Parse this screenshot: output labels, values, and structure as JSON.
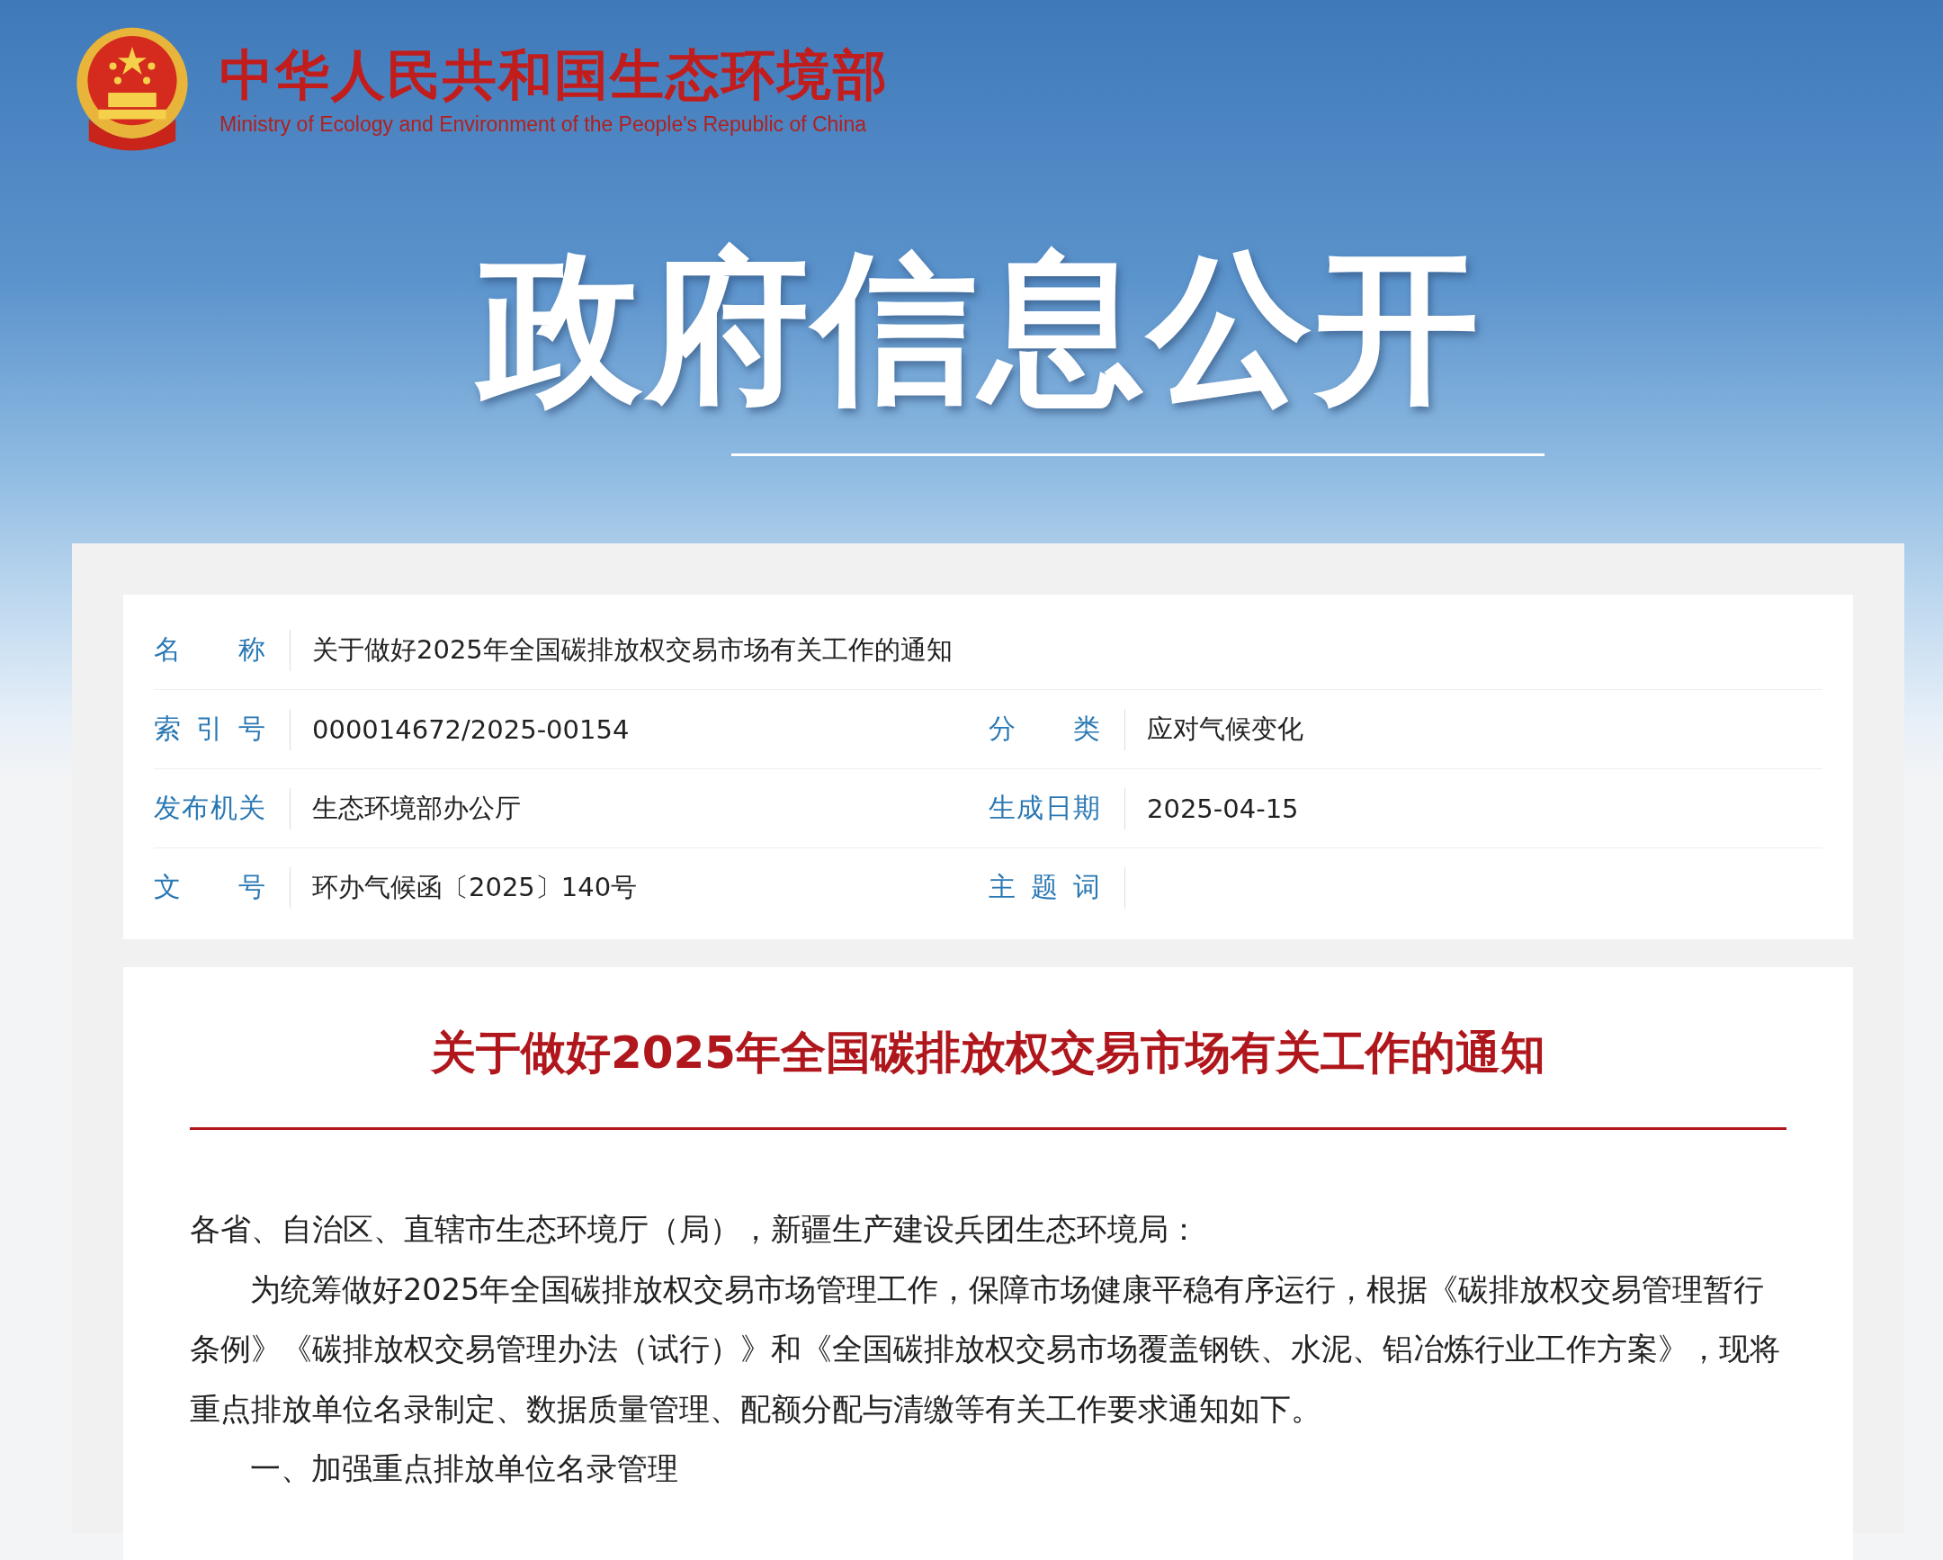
{
  "header": {
    "title": "中华人民共和国生态环境部",
    "subtitle": "Ministry of Ecology and Environment of the People's Republic of China"
  },
  "banner": {
    "title": "政府信息公开"
  },
  "meta": {
    "rows": [
      {
        "cells": [
          {
            "label": "名称",
            "value": "关于做好2025年全国碳排放权交易市场有关工作的通知"
          }
        ]
      },
      {
        "cells": [
          {
            "label": "索引号",
            "value": "000014672/2025-00154"
          },
          {
            "label": "分类",
            "value": "应对气候变化"
          }
        ]
      },
      {
        "cells": [
          {
            "label": "发布机关",
            "value": "生态环境部办公厅"
          },
          {
            "label": "生成日期",
            "value": "2025-04-15"
          }
        ]
      },
      {
        "cells": [
          {
            "label": "文号",
            "value": "环办气候函〔2025〕140号"
          },
          {
            "label": "主题词"
          }
        ]
      }
    ]
  },
  "article": {
    "title": "关于做好2025年全国碳排放权交易市场有关工作的通知",
    "paragraphs": [
      {
        "kind": "salutation",
        "text": "各省、自治区、直辖市生态环境厅（局），新疆生产建设兵团生态环境局："
      },
      {
        "kind": "body",
        "text": "为统筹做好2025年全国碳排放权交易市场管理工作，保障市场健康平稳有序运行，根据《碳排放权交易管理暂行条例》《碳排放权交易管理办法（试行）》和《全国碳排放权交易市场覆盖钢铁、水泥、铝冶炼行业工作方案》，现将重点排放单位名录制定、数据质量管理、配额分配与清缴等有关工作要求通知如下。"
      },
      {
        "kind": "heading",
        "text": "一、加强重点排放单位名录管理"
      }
    ]
  }
}
